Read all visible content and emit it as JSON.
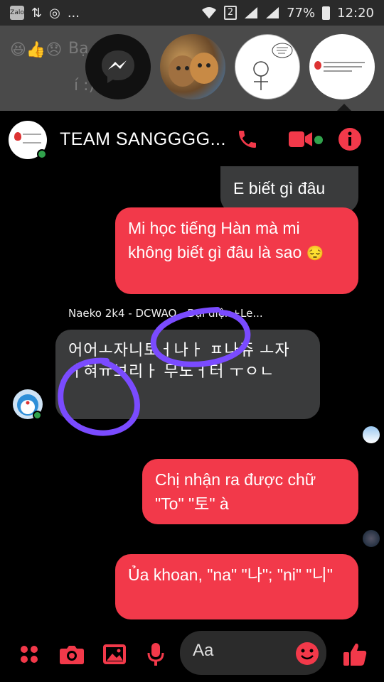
{
  "status_bar": {
    "app_badge": "Zalo",
    "dots": "...",
    "sim_slot": "2",
    "battery": "77%",
    "time": "12:20"
  },
  "background_ghost": {
    "line1": "Bạ          ng        vừ",
    "line2": "í :)"
  },
  "chat": {
    "title": "TEAM SANGGGG...",
    "accent_color": "#f2394a",
    "messages": [
      {
        "side": "right",
        "text": "E biết gì đâu"
      },
      {
        "side": "right",
        "text": "Mi học tiếng Hàn mà mi không biết gì đâu là sao",
        "emoji": "😔"
      },
      {
        "side": "left",
        "sender": "Naeko 2k4 - DCWAO - Đại diện+Le...",
        "text": "어어ㅗ자니토ㅓ나ㅏ ㅍ나쥬 ㅗ자 ㅓ혀ㅠ보리ㅏ 무노ㅓ터 ㅜㅇㄴ"
      },
      {
        "side": "right",
        "text": "Chị nhận ra được chữ \"To\" \"토\" à"
      },
      {
        "side": "right",
        "text": "Ủa khoan, \"na\" \"나\"; \"ni\" \"니\""
      }
    ]
  },
  "composer": {
    "placeholder": "Aa"
  },
  "icons": [
    "messenger-icon",
    "phone-icon",
    "video-icon",
    "info-icon",
    "apps-icon",
    "camera-icon",
    "image-icon",
    "microphone-icon",
    "emoji-icon",
    "thumbs-up-icon"
  ]
}
